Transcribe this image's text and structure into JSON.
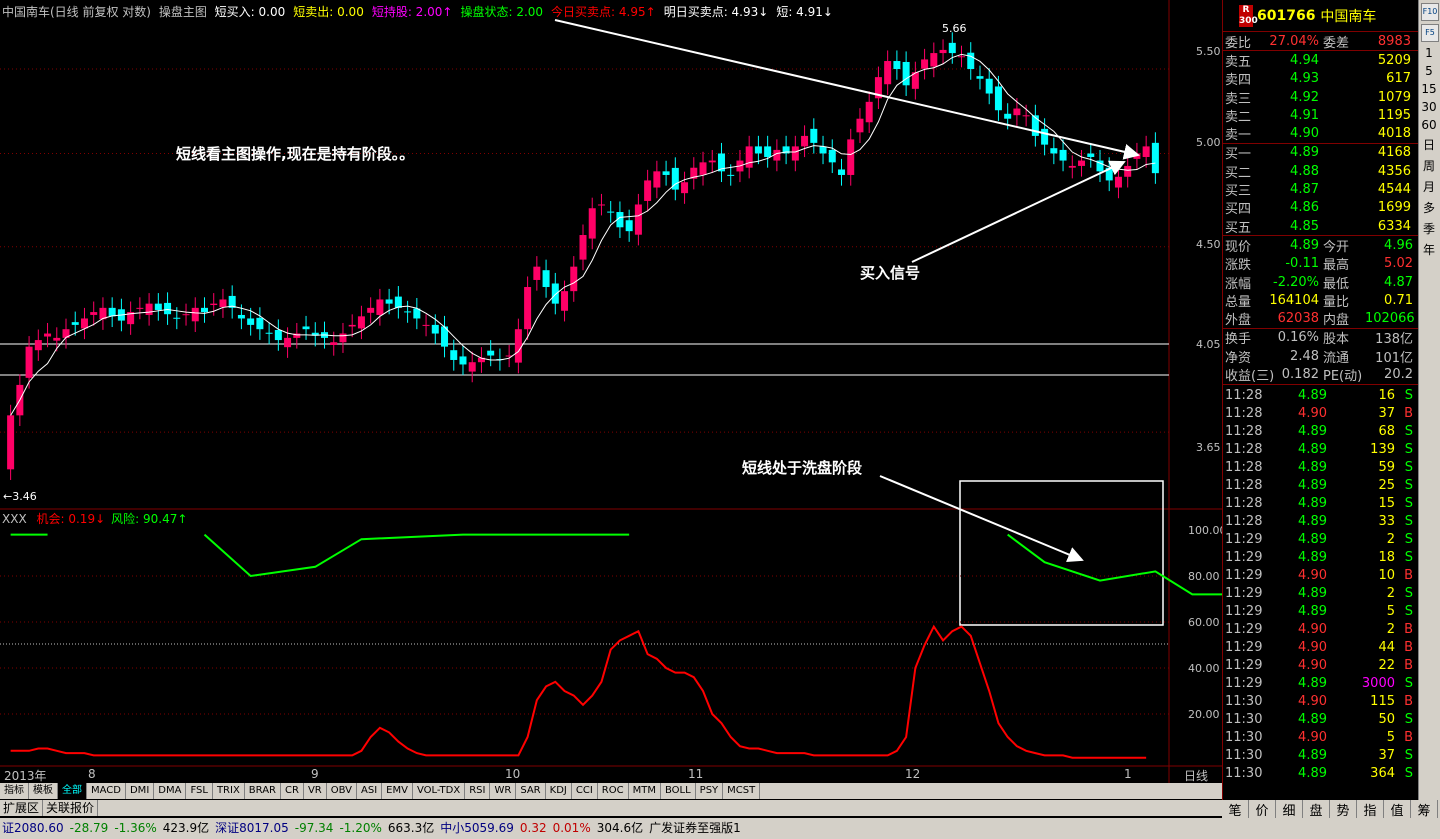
{
  "header": {
    "name": "中国南车(日线 前复权 对数)",
    "indicator": "操盘主图",
    "items": [
      {
        "label": "短买入: 0.00",
        "color": "#ffffff"
      },
      {
        "label": "短卖出: 0.00",
        "color": "#ffff00"
      },
      {
        "label": "短持股: 2.00↑",
        "color": "#ff00ff"
      },
      {
        "label": "操盘状态: 2.00",
        "color": "#00ff00"
      },
      {
        "label": "今日买卖点: 4.95↑",
        "color": "#ff0000"
      },
      {
        "label": "明日买卖点: 4.93↓",
        "color": "#ffffff"
      },
      {
        "label": "短: 4.91↓",
        "color": "#ffffff"
      }
    ]
  },
  "indicator": {
    "name": "XXX",
    "items": [
      {
        "label": "机会: 0.19↓",
        "color": "#ff0000"
      },
      {
        "label": "风险: 90.47↑",
        "color": "#00ff00"
      }
    ]
  },
  "annotations": {
    "note1": "短线看主图操作,现在是持有阶段。。",
    "note2": "买入信号",
    "note3": "短线处于洗盘阶段",
    "high": "5.66",
    "low": "←3.46"
  },
  "x_labels": [
    "2013年",
    "8",
    "9",
    "10",
    "11",
    "12",
    "1"
  ],
  "period": "日线",
  "quote": {
    "code": "601766",
    "name": "中国南车",
    "logo_top": "R",
    "logo_bottom": "300",
    "weibi": {
      "label": "委比",
      "value": "27.04%",
      "label2": "委差",
      "value2": "8983"
    },
    "asks": [
      {
        "label": "卖五",
        "price": "4.94",
        "vol": "5209"
      },
      {
        "label": "卖四",
        "price": "4.93",
        "vol": "617"
      },
      {
        "label": "卖三",
        "price": "4.92",
        "vol": "1079"
      },
      {
        "label": "卖二",
        "price": "4.91",
        "vol": "1195"
      },
      {
        "label": "卖一",
        "price": "4.90",
        "vol": "4018"
      }
    ],
    "bids": [
      {
        "label": "买一",
        "price": "4.89",
        "vol": "4168"
      },
      {
        "label": "买二",
        "price": "4.88",
        "vol": "4356"
      },
      {
        "label": "买三",
        "price": "4.87",
        "vol": "4544"
      },
      {
        "label": "买四",
        "price": "4.86",
        "vol": "1699"
      },
      {
        "label": "买五",
        "price": "4.85",
        "vol": "6334"
      }
    ],
    "stats1": [
      {
        "l": "现价",
        "v": "4.89",
        "vc": "#00ff00",
        "l2": "今开",
        "v2": "4.96",
        "v2c": "#00ff00"
      },
      {
        "l": "涨跌",
        "v": "-0.11",
        "vc": "#00ff00",
        "l2": "最高",
        "v2": "5.02",
        "v2c": "#ff3030"
      },
      {
        "l": "涨幅",
        "v": "-2.20%",
        "vc": "#00ff00",
        "l2": "最低",
        "v2": "4.87",
        "v2c": "#00ff00"
      },
      {
        "l": "总量",
        "v": "164104",
        "vc": "#ffff00",
        "l2": "量比",
        "v2": "0.71",
        "v2c": "#ffff00"
      },
      {
        "l": "外盘",
        "v": "62038",
        "vc": "#ff3030",
        "l2": "内盘",
        "v2": "102066",
        "v2c": "#00ff00"
      }
    ],
    "stats2": [
      {
        "l": "换手",
        "v": "0.16%",
        "vc": "#c0c0c0",
        "l2": "股本",
        "v2": "138亿",
        "v2c": "#c0c0c0"
      },
      {
        "l": "净资",
        "v": "2.48",
        "vc": "#c0c0c0",
        "l2": "流通",
        "v2": "101亿",
        "v2c": "#c0c0c0"
      },
      {
        "l": "收益(三)",
        "v": "0.182",
        "vc": "#c0c0c0",
        "l2": "PE(动)",
        "v2": "20.2",
        "v2c": "#c0c0c0"
      }
    ],
    "ticks": [
      [
        "11:28",
        "4.89",
        "16",
        "S"
      ],
      [
        "11:28",
        "4.90",
        "37",
        "B"
      ],
      [
        "11:28",
        "4.89",
        "68",
        "S"
      ],
      [
        "11:28",
        "4.89",
        "139",
        "S"
      ],
      [
        "11:28",
        "4.89",
        "59",
        "S"
      ],
      [
        "11:28",
        "4.89",
        "25",
        "S"
      ],
      [
        "11:28",
        "4.89",
        "15",
        "S"
      ],
      [
        "11:28",
        "4.89",
        "33",
        "S"
      ],
      [
        "11:29",
        "4.89",
        "2",
        "S"
      ],
      [
        "11:29",
        "4.89",
        "18",
        "S"
      ],
      [
        "11:29",
        "4.90",
        "10",
        "B"
      ],
      [
        "11:29",
        "4.89",
        "2",
        "S"
      ],
      [
        "11:29",
        "4.89",
        "5",
        "S"
      ],
      [
        "11:29",
        "4.90",
        "2",
        "B"
      ],
      [
        "11:29",
        "4.90",
        "44",
        "B"
      ],
      [
        "11:29",
        "4.90",
        "22",
        "B"
      ],
      [
        "11:29",
        "4.89",
        "3000",
        "S"
      ],
      [
        "11:30",
        "4.90",
        "115",
        "B"
      ],
      [
        "11:30",
        "4.89",
        "50",
        "S"
      ],
      [
        "11:30",
        "4.90",
        "5",
        "B"
      ],
      [
        "11:30",
        "4.89",
        "37",
        "S"
      ],
      [
        "11:30",
        "4.89",
        "364",
        "S"
      ]
    ]
  },
  "side_tools": [
    "F10",
    "F5",
    "1",
    "5",
    "15",
    "30",
    "60",
    "日",
    "周",
    "月",
    "多",
    "季",
    "年"
  ],
  "tabs": [
    "指标",
    "模板",
    "全部",
    "MACD",
    "DMI",
    "DMA",
    "FSL",
    "TRIX",
    "BRAR",
    "CR",
    "VR",
    "OBV",
    "ASI",
    "EMV",
    "VOL-TDX",
    "RSI",
    "WR",
    "SAR",
    "KDJ",
    "CCI",
    "ROC",
    "MTM",
    "BOLL",
    "PSY",
    "MCST"
  ],
  "tabs2": [
    "扩展区",
    "关联报价"
  ],
  "right_tabs": [
    "笔",
    "价",
    "细",
    "盘",
    "势",
    "指",
    "值",
    "筹"
  ],
  "status": [
    {
      "t": "证2080.60",
      "c": "#000080"
    },
    {
      "t": "-28.79",
      "c": "#008000"
    },
    {
      "t": "-1.36%",
      "c": "#008000"
    },
    {
      "t": "423.9亿",
      "c": "#000000"
    },
    {
      "t": "深证8017.05",
      "c": "#000080"
    },
    {
      "t": "-97.34",
      "c": "#008000"
    },
    {
      "t": "-1.20%",
      "c": "#008000"
    },
    {
      "t": "663.3亿",
      "c": "#000000"
    },
    {
      "t": "中小5059.69",
      "c": "#000080"
    },
    {
      "t": "0.32",
      "c": "#c00000"
    },
    {
      "t": "0.01%",
      "c": "#c00000"
    },
    {
      "t": "304.6亿",
      "c": "#000000"
    },
    {
      "t": "广发证券至强版1",
      "c": "#000000"
    }
  ],
  "colors": {
    "up": "#ff0066",
    "down": "#00ffff",
    "ma": "#ffffff",
    "chance": "#ff0000",
    "risk": "#00ff00"
  },
  "chart_data": {
    "type": "candlestick",
    "title": "中国南车(日线 前复权 对数)",
    "y_ticks": [
      "5.50",
      "5.00",
      "4.50",
      "4.05",
      "3.65"
    ],
    "sub_y_ticks": [
      "100.00",
      "80.00",
      "60.00",
      "40.00",
      "20.00"
    ],
    "high": 5.66,
    "low": 3.46,
    "closes": [
      3.72,
      3.85,
      4.02,
      4.05,
      4.08,
      4.06,
      4.1,
      4.12,
      4.15,
      4.18,
      4.2,
      4.16,
      4.14,
      4.18,
      4.2,
      4.22,
      4.19,
      4.17,
      4.15,
      4.17,
      4.2,
      4.18,
      4.22,
      4.24,
      4.2,
      4.15,
      4.12,
      4.1,
      4.08,
      4.05,
      4.06,
      4.08,
      4.1,
      4.07,
      4.06,
      4.04,
      4.08,
      4.12,
      4.16,
      4.2,
      4.24,
      4.22,
      4.2,
      4.18,
      4.15,
      4.12,
      4.08,
      4.02,
      3.96,
      3.94,
      3.95,
      3.97,
      3.98,
      3.96,
      3.98,
      4.1,
      4.3,
      4.4,
      4.3,
      4.22,
      4.28,
      4.4,
      4.56,
      4.7,
      4.72,
      4.68,
      4.6,
      4.58,
      4.72,
      4.85,
      4.9,
      4.88,
      4.8,
      4.84,
      4.92,
      4.95,
      4.96,
      4.9,
      4.88,
      4.96,
      5.04,
      5.0,
      4.98,
      5.02,
      5.0,
      5.04,
      5.1,
      5.06,
      5.0,
      4.95,
      4.88,
      5.08,
      5.2,
      5.3,
      5.45,
      5.55,
      5.5,
      5.4,
      5.48,
      5.56,
      5.6,
      5.62,
      5.6,
      5.58,
      5.5,
      5.44,
      5.35,
      5.25,
      5.2,
      5.26,
      5.22,
      5.1,
      5.05,
      5.0,
      4.96,
      4.93,
      4.96,
      4.98,
      4.9,
      4.85,
      4.87,
      4.93,
      5.0,
      5.04,
      4.89
    ],
    "chance": [
      4,
      4,
      4,
      5,
      5,
      4,
      3,
      3,
      3,
      2,
      2,
      2,
      2,
      2,
      2,
      2,
      2,
      2,
      2,
      2,
      2,
      2,
      2,
      2,
      2,
      2,
      2,
      2,
      2,
      2,
      2,
      2,
      2,
      2,
      2,
      2,
      2,
      2,
      4,
      10,
      14,
      12,
      8,
      5,
      3,
      2,
      2,
      2,
      2,
      2,
      2,
      2,
      2,
      2,
      2,
      2,
      10,
      26,
      32,
      34,
      30,
      28,
      24,
      28,
      34,
      48,
      52,
      54,
      56,
      46,
      44,
      40,
      38,
      38,
      36,
      30,
      20,
      16,
      10,
      6,
      5,
      5,
      4,
      3,
      3,
      3,
      3,
      2,
      2,
      2,
      2,
      2,
      2,
      2,
      2,
      2,
      4,
      10,
      40,
      50,
      58,
      52,
      56,
      58,
      54,
      42,
      30,
      16,
      10,
      6,
      4,
      3,
      2,
      2,
      2,
      1,
      1,
      1,
      1,
      1,
      1,
      1,
      1,
      1
    ],
    "risk_segments": [
      [
        [
          0,
          98
        ],
        [
          4,
          98
        ]
      ],
      [
        [
          21,
          98
        ],
        [
          26,
          80
        ],
        [
          33,
          84
        ],
        [
          38,
          96
        ],
        [
          49,
          98
        ],
        [
          67,
          98
        ]
      ],
      [
        [
          108,
          98
        ],
        [
          112,
          86
        ],
        [
          118,
          78
        ],
        [
          124,
          82
        ],
        [
          128,
          72
        ],
        [
          132,
          72
        ],
        [
          136,
          78
        ],
        [
          141,
          84
        ],
        [
          145,
          88
        ]
      ]
    ]
  }
}
